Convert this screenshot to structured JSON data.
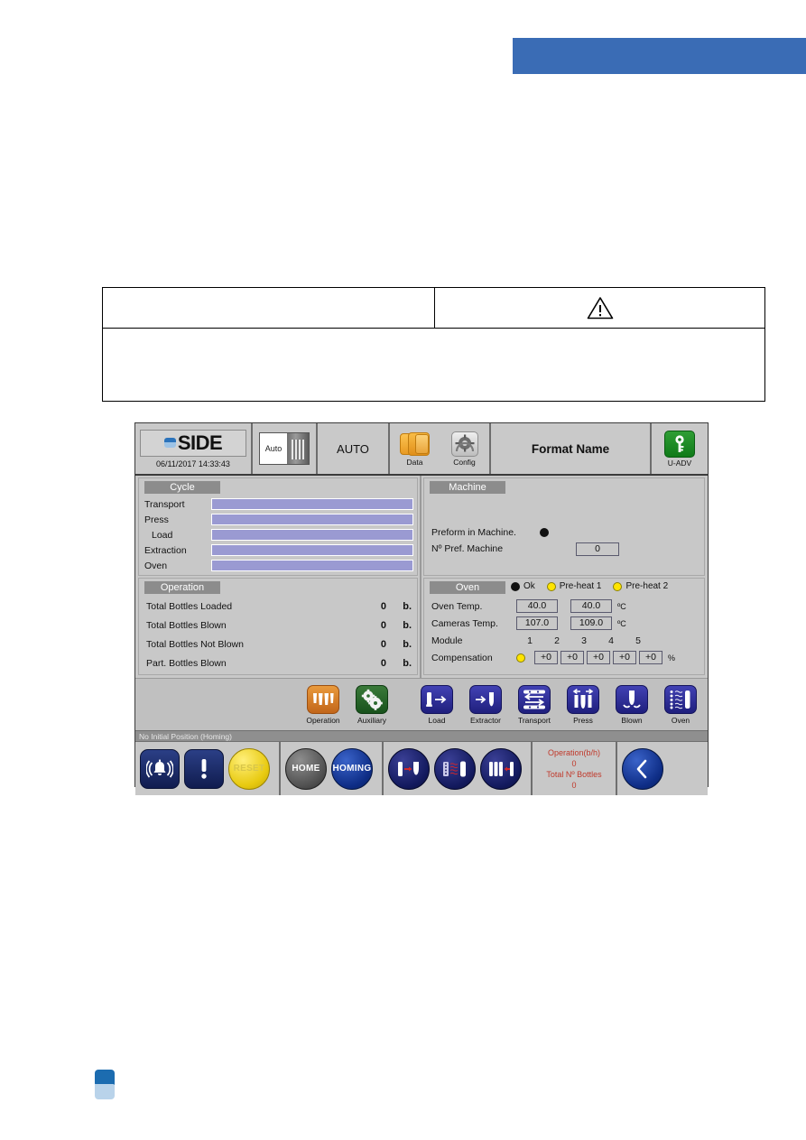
{
  "document": {
    "top_banner_color": "#3a6cb5",
    "warning_table": {
      "left_cell_text": "",
      "right_cell_icon": "warning-triangle-icon",
      "body_text": ""
    },
    "footer_logo": "side-logo-mark"
  },
  "hmi": {
    "header": {
      "brand_name": "SIDE",
      "datetime": "06/11/2017 14:33:43",
      "mode_switch_label": "Auto",
      "mode_label": "AUTO",
      "data_icon_label": "Data",
      "config_icon_label": "Config",
      "format_name": "Format Name",
      "user_label": "U-ADV"
    },
    "cycle": {
      "title": "Cycle",
      "rows": [
        {
          "label": "Transport",
          "progress": 100
        },
        {
          "label": "Press",
          "progress": 100
        },
        {
          "label": "Load",
          "progress": 100
        },
        {
          "label": "Extraction",
          "progress": 100
        },
        {
          "label": "Oven",
          "progress": 100
        }
      ]
    },
    "operation": {
      "title": "Operation",
      "rows": [
        {
          "label": "Total Bottles Loaded",
          "value": "0",
          "unit": "b."
        },
        {
          "label": "Total Bottles Blown",
          "value": "0",
          "unit": "b."
        },
        {
          "label": "Total Bottles Not Blown",
          "value": "0",
          "unit": "b."
        },
        {
          "label": "Part. Bottles Blown",
          "value": "0",
          "unit": "b."
        }
      ]
    },
    "machine": {
      "title": "Machine",
      "preform_label": "Preform in Machine.",
      "preform_led": "#111111",
      "pref_count_label": "Nº Pref. Machine",
      "pref_count_value": "0"
    },
    "oven": {
      "title": "Oven",
      "status": [
        {
          "label": "Ok",
          "color": "#111111"
        },
        {
          "label": "Pre-heat 1",
          "color": "#ffe400"
        },
        {
          "label": "Pre-heat 2",
          "color": "#ffe400"
        }
      ],
      "oven_temp_label": "Oven Temp.",
      "oven_temp_1": "40.0",
      "oven_temp_2": "40.0",
      "oven_temp_unit": "ºC",
      "cameras_temp_label": "Cameras Temp.",
      "cameras_temp_1": "107.0",
      "cameras_temp_2": "109.0",
      "cameras_temp_unit": "ºC",
      "module_label": "Module",
      "modules": [
        "1",
        "2",
        "3",
        "4",
        "5"
      ],
      "compensation_label": "Compensation",
      "compensation_led": "#ffe400",
      "compensation_values": [
        "+0",
        "+0",
        "+0",
        "+0",
        "+0"
      ],
      "compensation_unit": "%"
    },
    "nav": [
      {
        "label": "Operation",
        "icon": "teeth-mold-icon",
        "style": "orange"
      },
      {
        "label": "Auxiliary",
        "icon": "gears-icon",
        "style": "green"
      },
      {
        "label": "Load",
        "icon": "load-arrow-icon",
        "style": "blue"
      },
      {
        "label": "Extractor",
        "icon": "extractor-arrow-icon",
        "style": "blue"
      },
      {
        "label": "Transport",
        "icon": "transport-belt-icon",
        "style": "blue"
      },
      {
        "label": "Press",
        "icon": "press-mold-icon",
        "style": "blue"
      },
      {
        "label": "Blown",
        "icon": "blown-bottle-icon",
        "style": "blue"
      },
      {
        "label": "Oven",
        "icon": "oven-lamps-icon",
        "style": "blue"
      }
    ],
    "status_bar": "No Initial Position (Homing)",
    "bottom_bar": {
      "alarm_icon": "alarm-bell-icon",
      "warning_icon": "exclamation-icon",
      "reset_label": "RESET",
      "home_label": "HOME",
      "homing_label": "HOMING",
      "action_icons": [
        "preform-transfer-icon",
        "oven-heat-icon",
        "mold-row-icon"
      ],
      "counters": {
        "operation_label": "Operation(b/h)",
        "operation_value": "0",
        "total_label": "Total Nº Bottles",
        "total_value": "0"
      },
      "back_icon": "chevron-left-icon"
    }
  }
}
